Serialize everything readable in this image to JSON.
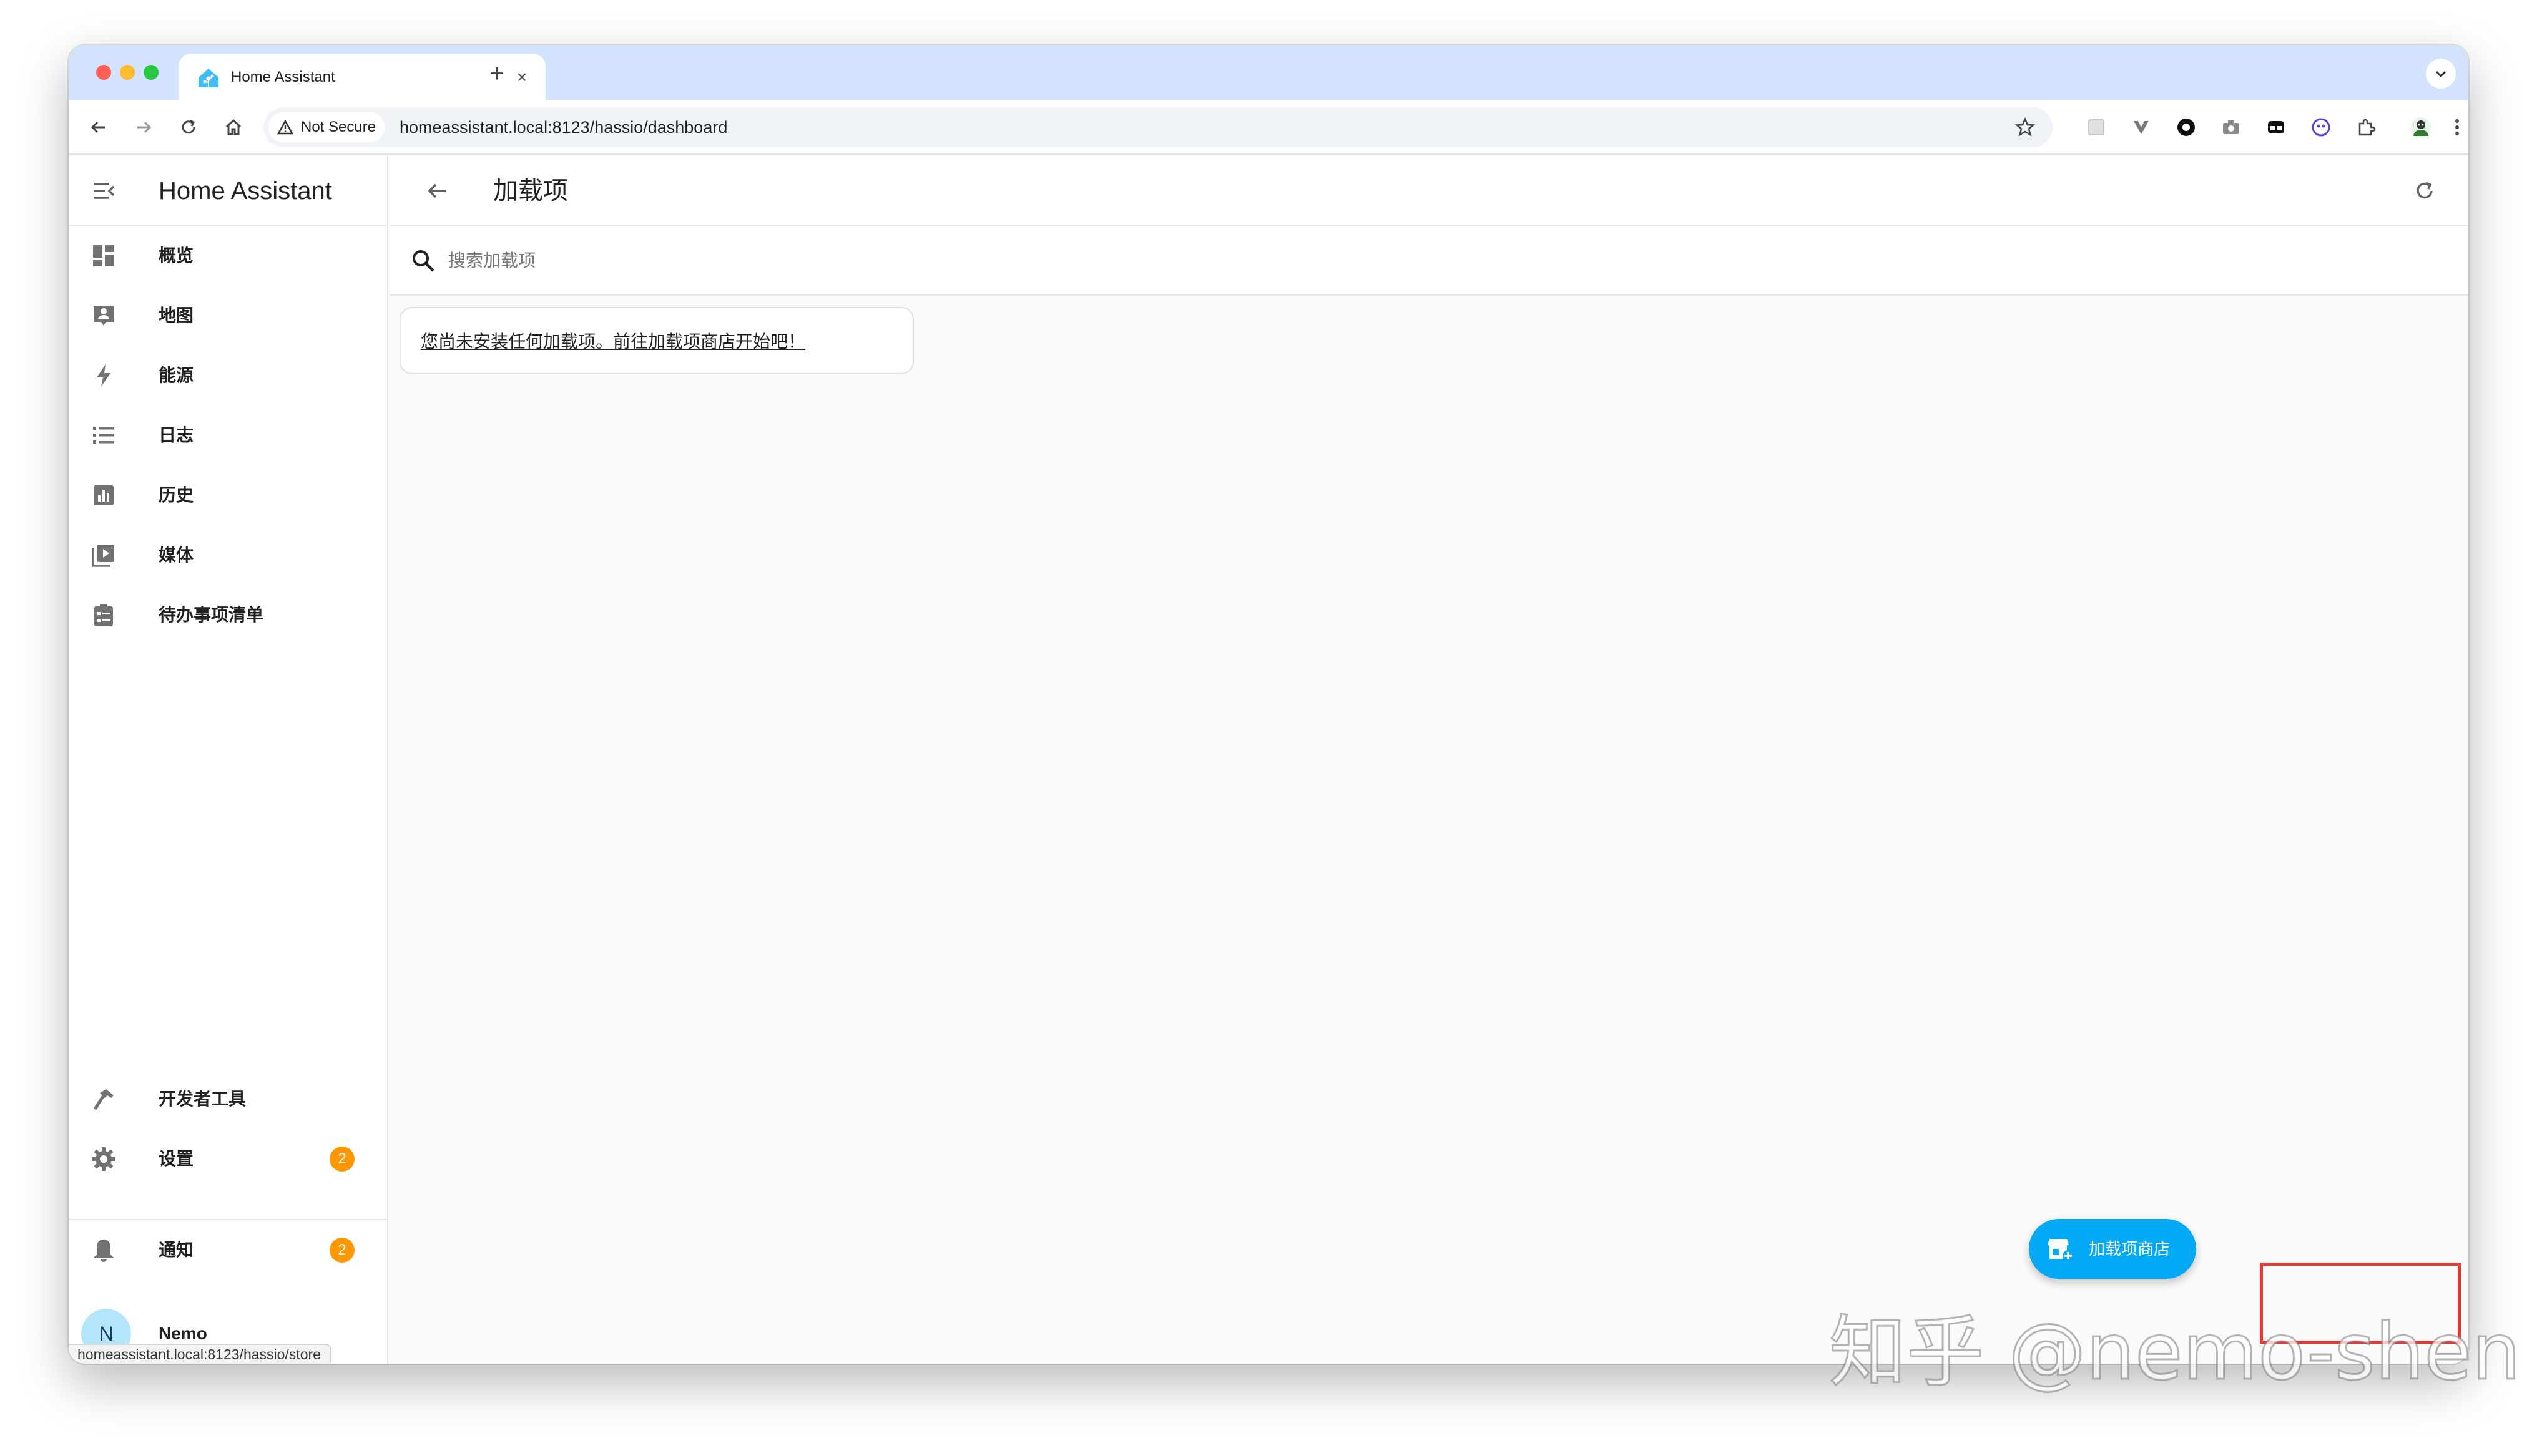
{
  "browser": {
    "tab_title": "Home Assistant",
    "security_label": "Not Secure",
    "url": "homeassistant.local:8123/hassio/dashboard",
    "status_url": "homeassistant.local:8123/hassio/store"
  },
  "sidebar": {
    "title": "Home Assistant",
    "items": [
      {
        "label": "概览",
        "icon": "dashboard-icon"
      },
      {
        "label": "地图",
        "icon": "map-account-icon"
      },
      {
        "label": "能源",
        "icon": "lightning-bolt-icon"
      },
      {
        "label": "日志",
        "icon": "logbook-list-icon"
      },
      {
        "label": "历史",
        "icon": "history-chart-icon"
      },
      {
        "label": "媒体",
        "icon": "media-play-icon"
      },
      {
        "label": "待办事项清单",
        "icon": "todo-clipboard-icon"
      }
    ],
    "bottom_items": [
      {
        "label": "开发者工具",
        "icon": "hammer-icon"
      },
      {
        "label": "设置",
        "icon": "gear-icon",
        "badge": "2"
      }
    ],
    "notifications": {
      "label": "通知",
      "icon": "bell-icon",
      "badge": "2"
    },
    "user": {
      "initial": "N",
      "name": "Nemo"
    }
  },
  "main": {
    "title": "加载项",
    "search_placeholder": "搜索加载项",
    "empty_message": "您尚未安装任何加载项。前往加载项商店开始吧！",
    "fab_label": "加载项商店"
  },
  "watermark": "知乎 @nemo-shen",
  "colors": {
    "accent": "#03a9f4",
    "badge": "#ff9800",
    "highlight": "#e53935",
    "tabstrip": "#d3e3fd"
  }
}
